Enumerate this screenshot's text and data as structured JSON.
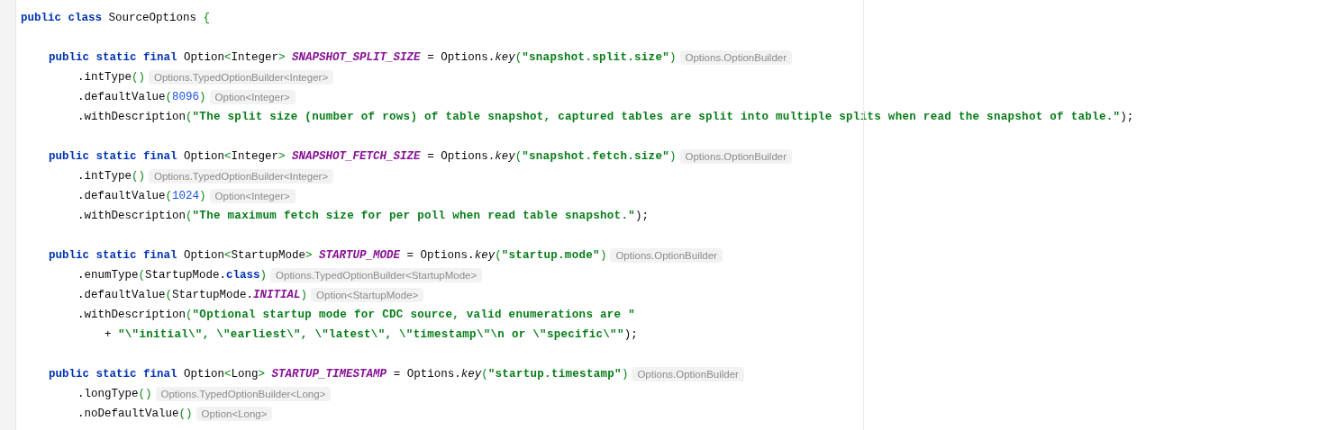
{
  "editor": {
    "lines": [
      {
        "kind": "top",
        "tokens": [
          {
            "kind": "kw",
            "text": "public class"
          },
          {
            "kind": "plain",
            "text": " SourceOptions "
          },
          {
            "kind": "punct",
            "text": "{"
          }
        ]
      },
      {
        "kind": "blank"
      },
      {
        "kind": "member",
        "tokens": [
          {
            "kind": "kw",
            "text": "public static final "
          },
          {
            "kind": "plain",
            "text": "Option"
          },
          {
            "kind": "punct",
            "text": "<"
          },
          {
            "kind": "plain",
            "text": "Integer"
          },
          {
            "kind": "punct",
            "text": "> "
          },
          {
            "kind": "const",
            "text": "SNAPSHOT_SPLIT_SIZE"
          },
          {
            "kind": "plain",
            "text": " = Options."
          },
          {
            "kind": "method",
            "text": "key"
          },
          {
            "kind": "punct",
            "text": "("
          },
          {
            "kind": "str",
            "text": "\"snapshot.split.size\""
          },
          {
            "kind": "punct",
            "text": ")"
          }
        ],
        "hint": "Options.OptionBuilder"
      },
      {
        "kind": "chain",
        "tokens": [
          {
            "kind": "plain",
            "text": ".intType"
          },
          {
            "kind": "punct",
            "text": "()"
          }
        ],
        "hint": "Options.TypedOptionBuilder<Integer>"
      },
      {
        "kind": "chain",
        "tokens": [
          {
            "kind": "plain",
            "text": ".defaultValue"
          },
          {
            "kind": "punct",
            "text": "("
          },
          {
            "kind": "num",
            "text": "8096"
          },
          {
            "kind": "punct",
            "text": ")"
          }
        ],
        "hint": "Option<Integer>"
      },
      {
        "kind": "chain",
        "tokens": [
          {
            "kind": "plain",
            "text": ".withDescription"
          },
          {
            "kind": "punct",
            "text": "("
          },
          {
            "kind": "str",
            "text": "\"The split size (number of rows) of table snapshot, captured tables are split into multiple splits when read the snapshot of table.\""
          },
          {
            "kind": "plain",
            "text": ");"
          }
        ]
      },
      {
        "kind": "blank"
      },
      {
        "kind": "member",
        "tokens": [
          {
            "kind": "kw",
            "text": "public static final "
          },
          {
            "kind": "plain",
            "text": "Option"
          },
          {
            "kind": "punct",
            "text": "<"
          },
          {
            "kind": "plain",
            "text": "Integer"
          },
          {
            "kind": "punct",
            "text": "> "
          },
          {
            "kind": "const",
            "text": "SNAPSHOT_FETCH_SIZE"
          },
          {
            "kind": "plain",
            "text": " = Options."
          },
          {
            "kind": "method",
            "text": "key"
          },
          {
            "kind": "punct",
            "text": "("
          },
          {
            "kind": "str",
            "text": "\"snapshot.fetch.size\""
          },
          {
            "kind": "punct",
            "text": ")"
          }
        ],
        "hint": "Options.OptionBuilder"
      },
      {
        "kind": "chain",
        "tokens": [
          {
            "kind": "plain",
            "text": ".intType"
          },
          {
            "kind": "punct",
            "text": "()"
          }
        ],
        "hint": "Options.TypedOptionBuilder<Integer>"
      },
      {
        "kind": "chain",
        "tokens": [
          {
            "kind": "plain",
            "text": ".defaultValue"
          },
          {
            "kind": "punct",
            "text": "("
          },
          {
            "kind": "num",
            "text": "1024"
          },
          {
            "kind": "punct",
            "text": ")"
          }
        ],
        "hint": "Option<Integer>"
      },
      {
        "kind": "chain",
        "tokens": [
          {
            "kind": "plain",
            "text": ".withDescription"
          },
          {
            "kind": "punct",
            "text": "("
          },
          {
            "kind": "str",
            "text": "\"The maximum fetch size for per poll when read table snapshot.\""
          },
          {
            "kind": "plain",
            "text": ");"
          }
        ]
      },
      {
        "kind": "blank"
      },
      {
        "kind": "member",
        "tokens": [
          {
            "kind": "kw",
            "text": "public static final "
          },
          {
            "kind": "plain",
            "text": "Option"
          },
          {
            "kind": "punct",
            "text": "<"
          },
          {
            "kind": "plain",
            "text": "StartupMode"
          },
          {
            "kind": "punct",
            "text": "> "
          },
          {
            "kind": "const",
            "text": "STARTUP_MODE"
          },
          {
            "kind": "plain",
            "text": " = Options."
          },
          {
            "kind": "method",
            "text": "key"
          },
          {
            "kind": "punct",
            "text": "("
          },
          {
            "kind": "str",
            "text": "\"startup.mode\""
          },
          {
            "kind": "punct",
            "text": ")"
          }
        ],
        "hint": "Options.OptionBuilder"
      },
      {
        "kind": "chain",
        "tokens": [
          {
            "kind": "plain",
            "text": ".enumType"
          },
          {
            "kind": "punct",
            "text": "("
          },
          {
            "kind": "plain",
            "text": "StartupMode."
          },
          {
            "kind": "kw",
            "text": "class"
          },
          {
            "kind": "punct",
            "text": ")"
          }
        ],
        "hint": "Options.TypedOptionBuilder<StartupMode>"
      },
      {
        "kind": "chain",
        "tokens": [
          {
            "kind": "plain",
            "text": ".defaultValue"
          },
          {
            "kind": "punct",
            "text": "("
          },
          {
            "kind": "plain",
            "text": "StartupMode."
          },
          {
            "kind": "const",
            "text": "INITIAL"
          },
          {
            "kind": "punct",
            "text": ")"
          }
        ],
        "hint": "Option<StartupMode>"
      },
      {
        "kind": "chain",
        "tokens": [
          {
            "kind": "plain",
            "text": ".withDescription"
          },
          {
            "kind": "punct",
            "text": "("
          },
          {
            "kind": "str",
            "text": "\"Optional startup mode for CDC source, valid enumerations are \""
          }
        ]
      },
      {
        "kind": "continuation",
        "tokens": [
          {
            "kind": "plain",
            "text": "+ "
          },
          {
            "kind": "str",
            "text": "\"\\\"initial\\\", \\\"earliest\\\", \\\"latest\\\", \\\"timestamp\\\"\\n or \\\"specific\\\"\""
          },
          {
            "kind": "plain",
            "text": ");"
          }
        ]
      },
      {
        "kind": "blank"
      },
      {
        "kind": "member",
        "tokens": [
          {
            "kind": "kw",
            "text": "public static final "
          },
          {
            "kind": "plain",
            "text": "Option"
          },
          {
            "kind": "punct",
            "text": "<"
          },
          {
            "kind": "plain",
            "text": "Long"
          },
          {
            "kind": "punct",
            "text": "> "
          },
          {
            "kind": "const",
            "text": "STARTUP_TIMESTAMP"
          },
          {
            "kind": "plain",
            "text": " = Options."
          },
          {
            "kind": "method",
            "text": "key"
          },
          {
            "kind": "punct",
            "text": "("
          },
          {
            "kind": "str",
            "text": "\"startup.timestamp\""
          },
          {
            "kind": "punct",
            "text": ")"
          }
        ],
        "hint": "Options.OptionBuilder"
      },
      {
        "kind": "chain",
        "tokens": [
          {
            "kind": "plain",
            "text": ".longType"
          },
          {
            "kind": "punct",
            "text": "()"
          }
        ],
        "hint": "Options.TypedOptionBuilder<Long>"
      },
      {
        "kind": "chain",
        "tokens": [
          {
            "kind": "plain",
            "text": ".noDefaultValue"
          },
          {
            "kind": "punct",
            "text": "()"
          }
        ],
        "hint": "Option<Long>"
      }
    ]
  }
}
